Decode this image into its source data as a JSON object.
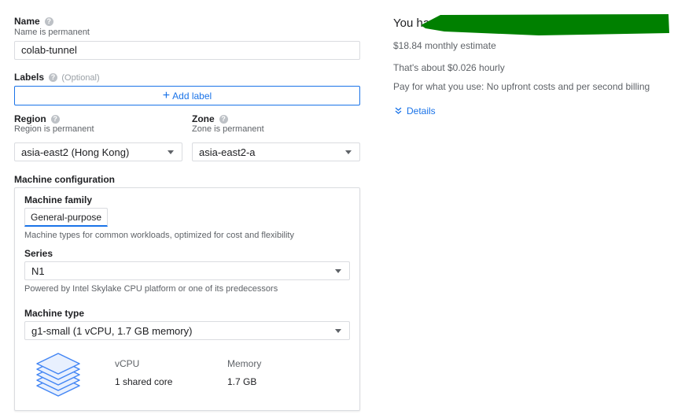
{
  "name": {
    "label": "Name",
    "sublabel": "Name is permanent",
    "value": "colab-tunnel"
  },
  "labels": {
    "label": "Labels",
    "optional": "(Optional)",
    "add_label": "Add label"
  },
  "region": {
    "label": "Region",
    "sublabel": "Region is permanent",
    "value": "asia-east2 (Hong Kong)"
  },
  "zone": {
    "label": "Zone",
    "sublabel": "Zone is permanent",
    "value": "asia-east2-a"
  },
  "machine": {
    "label": "Machine configuration",
    "family_label": "Machine family",
    "family_tab": "General-purpose",
    "family_desc": "Machine types for common workloads, optimized for cost and flexibility",
    "series_label": "Series",
    "series_value": "N1",
    "series_desc": "Powered by Intel Skylake CPU platform or one of its predecessors",
    "type_label": "Machine type",
    "type_value": "g1-small (1 vCPU, 1.7 GB memory)",
    "vcpu_header": "vCPU",
    "vcpu_value": "1 shared core",
    "memory_header": "Memory",
    "memory_value": "1.7 GB"
  },
  "estimate": {
    "heading": "You have",
    "monthly": "$18.84 monthly estimate",
    "hourly": "That's about $0.026 hourly",
    "billing": "Pay for what you use: No upfront costs and per second billing",
    "details": "Details"
  },
  "colors": {
    "accent": "#1a73e8",
    "redaction": "#008000"
  }
}
